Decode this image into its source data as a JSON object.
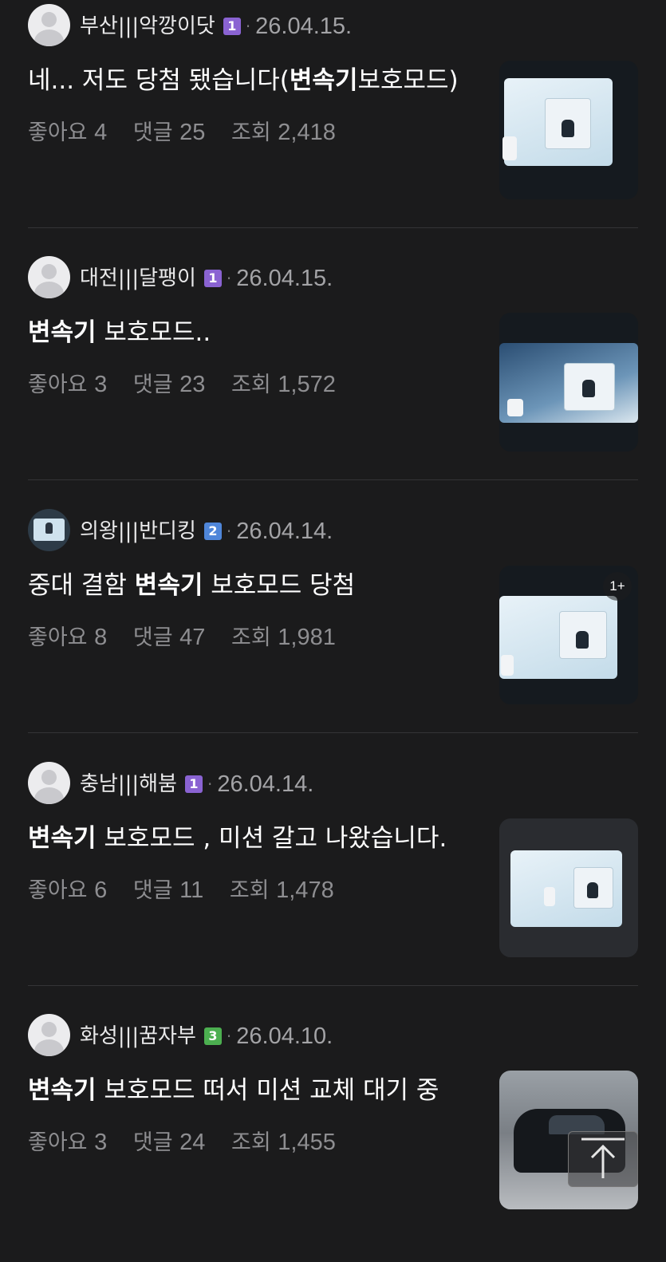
{
  "posts": [
    {
      "author": "부산|||악깡이닷",
      "level": "1",
      "level_color": "#8a63d2",
      "date": "26.04.15.",
      "title_pre": "네... 저도 당첨 됐습니다(",
      "title_bold": "변속기",
      "title_post": "보호모드)",
      "likes_label": "좋아요",
      "likes": "4",
      "comments_label": "댓글",
      "comments": "25",
      "views_label": "조회",
      "views": "2,418",
      "avatar": "default-avatar",
      "thumb": "dashboard-screen-photo",
      "thumb_badge": ""
    },
    {
      "author": "대전|||달팽이",
      "level": "1",
      "level_color": "#8a63d2",
      "date": "26.04.15.",
      "title_pre": "",
      "title_bold": "변속기",
      "title_post": " 보호모드..",
      "likes_label": "좋아요",
      "likes": "3",
      "comments_label": "댓글",
      "comments": "23",
      "views_label": "조회",
      "views": "1,572",
      "avatar": "default-avatar",
      "thumb": "dashboard-screen-photo",
      "thumb_badge": ""
    },
    {
      "author": "의왕|||반디킹",
      "level": "2",
      "level_color": "#4f86d9",
      "date": "26.04.14.",
      "title_pre": "중대 결함 ",
      "title_bold": "변속기",
      "title_post": " 보호모드 당첨",
      "likes_label": "좋아요",
      "likes": "8",
      "comments_label": "댓글",
      "comments": "47",
      "views_label": "조회",
      "views": "1,981",
      "avatar": "photo-avatar",
      "thumb": "dashboard-screen-photo",
      "thumb_badge": "1+"
    },
    {
      "author": "충남|||해붐",
      "level": "1",
      "level_color": "#8a63d2",
      "date": "26.04.14.",
      "title_pre": "",
      "title_bold": "변속기",
      "title_post": " 보호모드 , 미션 갈고 나왔습니다.",
      "likes_label": "좋아요",
      "likes": "6",
      "comments_label": "댓글",
      "comments": "11",
      "views_label": "조회",
      "views": "1,478",
      "avatar": "default-avatar",
      "thumb": "dashboard-screen-photo",
      "thumb_badge": ""
    },
    {
      "author": "화성|||꿈자부",
      "level": "3",
      "level_color": "#4caf50",
      "date": "26.04.10.",
      "title_pre": "",
      "title_bold": "변속기",
      "title_post": " 보호모드 떠서 미션 교체 대기 중",
      "likes_label": "좋아요",
      "likes": "3",
      "comments_label": "댓글",
      "comments": "24",
      "views_label": "조회",
      "views": "1,455",
      "avatar": "default-avatar",
      "thumb": "car-street-photo",
      "thumb_badge": ""
    }
  ],
  "scroll_top": {
    "icon": "arrow-up-icon"
  },
  "colors": {
    "background": "#1b1b1c",
    "divider": "#343436",
    "meta_text": "#8e8e91"
  }
}
